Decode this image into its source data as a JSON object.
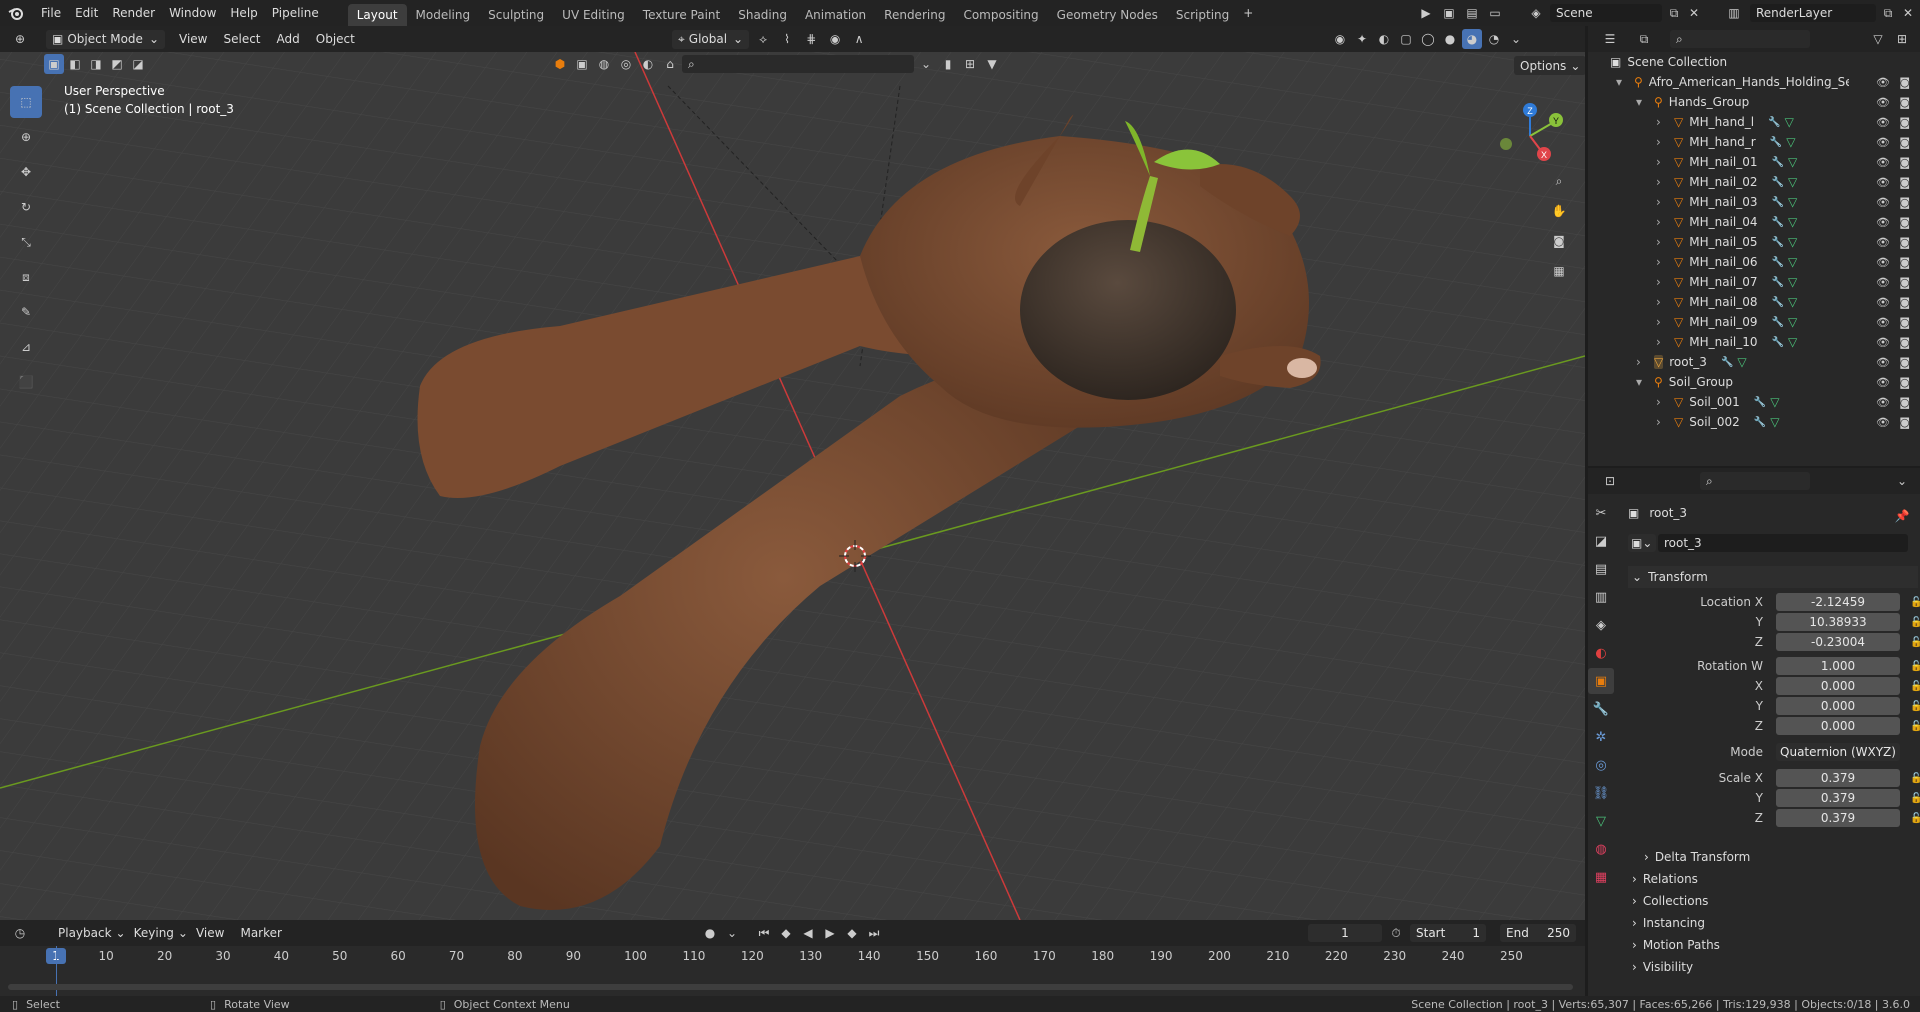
{
  "app": {
    "menus": [
      "File",
      "Edit",
      "Render",
      "Window",
      "Help",
      "Pipeline"
    ],
    "workspaces": [
      "Layout",
      "Modeling",
      "Sculpting",
      "UV Editing",
      "Texture Paint",
      "Shading",
      "Animation",
      "Rendering",
      "Compositing",
      "Geometry Nodes",
      "Scripting"
    ],
    "active_workspace": "Layout",
    "scene": "Scene",
    "view_layer": "RenderLayer"
  },
  "viewport": {
    "mode": "Object Mode",
    "menus": [
      "View",
      "Select",
      "Add",
      "Object"
    ],
    "orientation": "Global",
    "options_label": "Options",
    "perspective": "User Perspective",
    "collection_info": "(1) Scene Collection | root_3"
  },
  "gizmo": {
    "z": "Z",
    "y": "Y",
    "x": "X"
  },
  "outliner": {
    "root": "Scene Collection",
    "items": [
      {
        "label": "Afro_American_Hands_Holding_Seedling",
        "depth": 1,
        "kind": "armature"
      },
      {
        "label": "Hands_Group",
        "depth": 2,
        "kind": "armature"
      },
      {
        "label": "MH_hand_l",
        "depth": 3,
        "kind": "mesh"
      },
      {
        "label": "MH_hand_r",
        "depth": 3,
        "kind": "mesh"
      },
      {
        "label": "MH_nail_01",
        "depth": 3,
        "kind": "mesh"
      },
      {
        "label": "MH_nail_02",
        "depth": 3,
        "kind": "mesh"
      },
      {
        "label": "MH_nail_03",
        "depth": 3,
        "kind": "mesh"
      },
      {
        "label": "MH_nail_04",
        "depth": 3,
        "kind": "mesh"
      },
      {
        "label": "MH_nail_05",
        "depth": 3,
        "kind": "mesh"
      },
      {
        "label": "MH_nail_06",
        "depth": 3,
        "kind": "mesh"
      },
      {
        "label": "MH_nail_07",
        "depth": 3,
        "kind": "mesh"
      },
      {
        "label": "MH_nail_08",
        "depth": 3,
        "kind": "mesh"
      },
      {
        "label": "MH_nail_09",
        "depth": 3,
        "kind": "mesh"
      },
      {
        "label": "MH_nail_10",
        "depth": 3,
        "kind": "mesh"
      },
      {
        "label": "root_3",
        "depth": 2,
        "kind": "mesh-selected"
      },
      {
        "label": "Soil_Group",
        "depth": 2,
        "kind": "armature"
      },
      {
        "label": "Soil_001",
        "depth": 3,
        "kind": "mesh"
      },
      {
        "label": "Soil_002",
        "depth": 3,
        "kind": "mesh"
      }
    ]
  },
  "properties": {
    "object_name": "root_3",
    "datablock_name": "root_3",
    "transform_label": "Transform",
    "location": {
      "label": "Location X",
      "x": "-2.12459",
      "y": "10.38933",
      "z": "-0.23004"
    },
    "rotation": {
      "label": "Rotation W",
      "w": "1.000",
      "x": "0.000",
      "y": "0.000",
      "z": "0.000"
    },
    "axis_labels": {
      "x": "X",
      "y": "Y",
      "z": "Z"
    },
    "mode_label": "Mode",
    "mode_value": "Quaternion (WXYZ)",
    "scale": {
      "label": "Scale X",
      "x": "0.379",
      "y": "0.379",
      "z": "0.379"
    },
    "delta_transform": "Delta Transform",
    "sections": [
      "Relations",
      "Collections",
      "Instancing",
      "Motion Paths",
      "Visibility"
    ]
  },
  "timeline": {
    "menus": [
      "Playback",
      "Keying",
      "View",
      "Marker"
    ],
    "current_frame": "1",
    "start_label": "Start",
    "start": "1",
    "end_label": "End",
    "end": "250",
    "ruler": [
      "1",
      "10",
      "20",
      "30",
      "40",
      "50",
      "60",
      "70",
      "80",
      "90",
      "100",
      "110",
      "120",
      "130",
      "140",
      "150",
      "160",
      "170",
      "180",
      "190",
      "200",
      "210",
      "220",
      "230",
      "240",
      "250"
    ]
  },
  "status": {
    "select": "Select",
    "rotate": "Rotate View",
    "context": "Object Context Menu",
    "stats": "Scene Collection | root_3 | Verts:65,307 | Faces:65,266 | Tris:129,938 | Objects:0/18 | 3.6.0"
  },
  "colors": {
    "accent": "#4772b3",
    "mesh_orange": "#e87d0d",
    "modifier_blue": "#6b9bd8",
    "data_green": "#4bc27a",
    "x_axis": "#cc3a3a",
    "y_axis": "#6a9a1f"
  }
}
